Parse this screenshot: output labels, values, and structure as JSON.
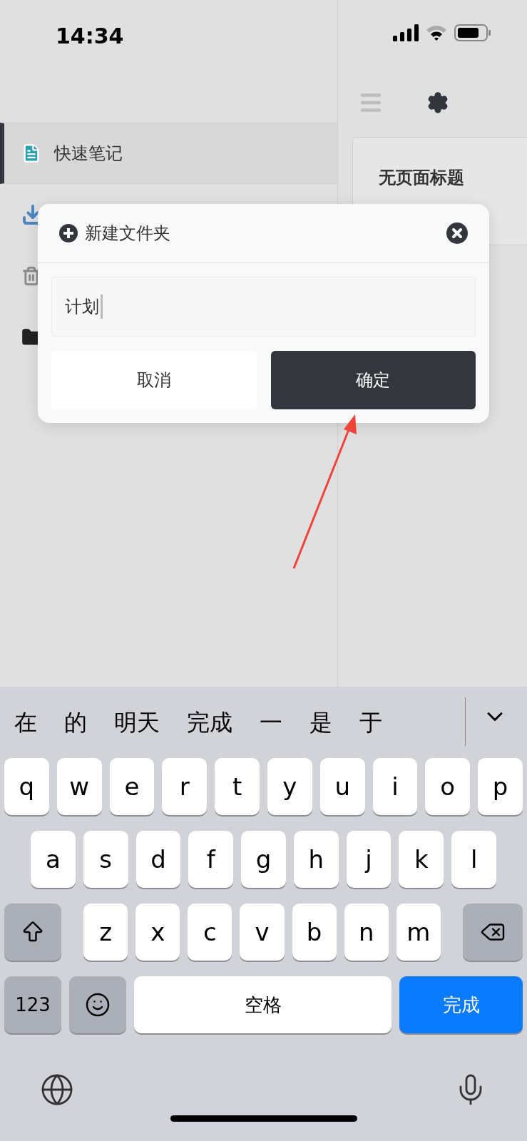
{
  "status_bar": {
    "time": "14:34"
  },
  "sidebar": {
    "items": [
      {
        "kind": "note",
        "label": "快速笔记",
        "selected": true
      },
      {
        "kind": "inbox",
        "selected": false
      },
      {
        "kind": "trash",
        "selected": false
      },
      {
        "kind": "folder",
        "selected": false
      }
    ]
  },
  "page_card": {
    "title": "无页面标题"
  },
  "dialog": {
    "title": "新建文件夹",
    "input": {
      "value": "计划"
    },
    "buttons": [
      {
        "label": "取消",
        "kind": "secondary"
      },
      {
        "label": "确定",
        "kind": "primary"
      }
    ]
  },
  "keyboard": {
    "candidates": [
      "在",
      "的",
      "明天",
      "完成",
      "一",
      "是",
      "于"
    ],
    "letter_rows": [
      [
        "q",
        "w",
        "e",
        "r",
        "t",
        "y",
        "u",
        "i",
        "o",
        "p"
      ],
      [
        "a",
        "s",
        "d",
        "f",
        "g",
        "h",
        "j",
        "k",
        "l"
      ],
      [
        "z",
        "x",
        "c",
        "v",
        "b",
        "n",
        "m"
      ]
    ],
    "numbers_key": "123",
    "space_key": "空格",
    "return_key": "完成"
  }
}
